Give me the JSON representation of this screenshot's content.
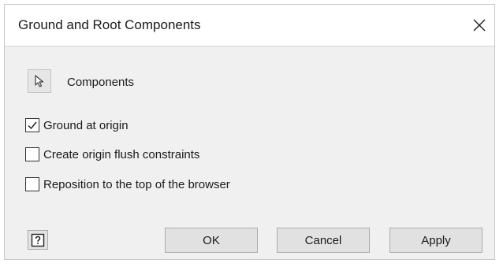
{
  "dialog": {
    "title": "Ground and Root Components",
    "close_icon": "close-icon"
  },
  "selection": {
    "icon": "arrow-cursor-icon",
    "label": "Components"
  },
  "options": [
    {
      "label": "Ground at origin",
      "checked": true
    },
    {
      "label": "Create origin flush constraints",
      "checked": false
    },
    {
      "label": "Reposition to the top of the browser",
      "checked": false
    }
  ],
  "footer": {
    "help_icon": "help-icon",
    "ok_label": "OK",
    "cancel_label": "Cancel",
    "apply_label": "Apply"
  }
}
